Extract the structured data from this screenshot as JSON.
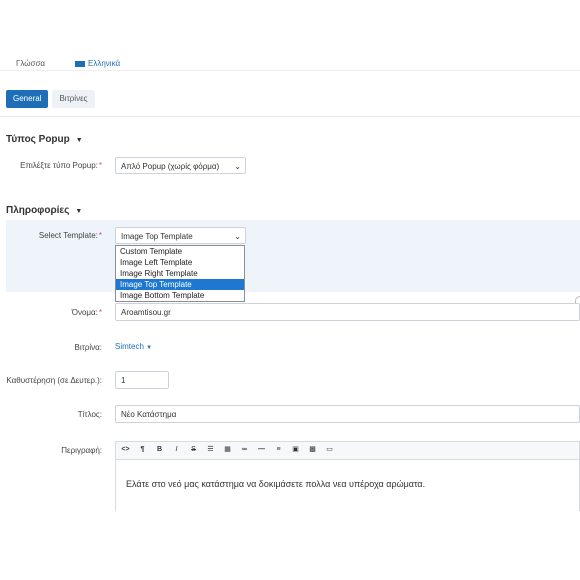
{
  "top": {
    "language_label": "Γλώσσα",
    "language_value": "Ελληνικά"
  },
  "tabs": [
    {
      "label": "General",
      "active": true
    },
    {
      "label": "Βιτρίνες",
      "active": false
    }
  ],
  "popup_type": {
    "section_title": "Τύπος Popup",
    "field_label": "Επιλέξτε τύπο Popup:",
    "value": "Απλό Popup (χωρίς φόρμα)"
  },
  "info": {
    "section_title": "Πληροφορίες",
    "template_label": "Select Template:",
    "template_value": "Image Top Template",
    "template_options": [
      {
        "label": "Custom Template",
        "selected": false
      },
      {
        "label": "Image Left Template",
        "selected": false
      },
      {
        "label": "Image Right Template",
        "selected": false
      },
      {
        "label": "Image Top Template",
        "selected": true
      },
      {
        "label": "Image Bottom Template",
        "selected": false
      }
    ],
    "name_label": "Όνομα:",
    "name_value": "Aroamtisou.gr",
    "storefront_label": "Βιτρίνα:",
    "storefront_value": "Simtech",
    "delay_label": "Καθυστέρηση (σε Δευτερ.):",
    "delay_value": "1",
    "title_label": "Τίτλος:",
    "title_value": "Νέο Κατάστημα",
    "description_label": "Περιγραφή:",
    "description_text": "Ελάτε στο νεό μας κατάστημα να δοκιμάσετε πολλα νεα υπέροχα αρώματα."
  },
  "required_mark": "*",
  "toolbar_icons": [
    "code-icon",
    "paragraph-icon",
    "bold-icon",
    "italic-icon",
    "strikethrough-icon",
    "unordered-list-icon",
    "ordered-list-icon",
    "link-icon",
    "horizontal-rule-icon",
    "align-icon",
    "image-icon",
    "gallery-icon",
    "video-icon"
  ],
  "colors": {
    "primary": "#1f6fb8",
    "selected_option": "#1e78d2",
    "required": "#d9534f",
    "band": "#eef4fa"
  }
}
